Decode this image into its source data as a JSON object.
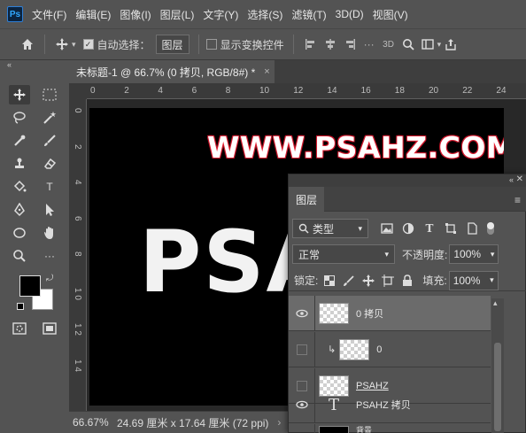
{
  "app": {
    "logo": "Ps"
  },
  "menu": [
    "文件(F)",
    "编辑(E)",
    "图像(I)",
    "图层(L)",
    "文字(Y)",
    "选择(S)",
    "滤镜(T)",
    "3D(D)",
    "视图(V)"
  ],
  "options": {
    "auto_select_label": "自动选择：",
    "auto_select_value": "图层",
    "show_transform_label": "显示变换控件"
  },
  "document_tab": {
    "title": "未标题-1 @ 66.7% (0 拷贝, RGB/8#) *",
    "close": "×"
  },
  "rulers": {
    "h_ticks": [
      "0",
      "2",
      "4",
      "6",
      "8",
      "10",
      "12",
      "14",
      "16",
      "18",
      "20",
      "22",
      "24"
    ],
    "v_ticks": [
      "0",
      "2",
      "4",
      "6",
      "8",
      "1 0",
      "1 2",
      "1 4"
    ]
  },
  "canvas": {
    "headline": "WWW.PSAHZ.COM",
    "big_text": "PSA",
    "headline_outline_color": "#d0142c"
  },
  "status": {
    "zoom": "66.67%",
    "doc_info": "24.69 厘米 x 17.64 厘米 (72 ppi)",
    "arrow": "›"
  },
  "layers_panel": {
    "tab_label": "图层",
    "filter_kind": "类型",
    "blend_mode": "正常",
    "opacity_label": "不透明度:",
    "opacity_value": "100%",
    "lock_label": "锁定:",
    "fill_label": "填充:",
    "fill_value": "100%",
    "layers": [
      {
        "name": "0 拷贝",
        "visible": true,
        "selected": true,
        "kind": "pixel"
      },
      {
        "name": "0",
        "visible": false,
        "selected": false,
        "kind": "pixel",
        "clipped": true
      },
      {
        "name": "PSAHZ",
        "visible": false,
        "selected": false,
        "kind": "pixel"
      },
      {
        "name": "PSAHZ 拷贝",
        "visible": true,
        "selected": false,
        "kind": "text"
      },
      {
        "name": "背景",
        "visible": true,
        "selected": false,
        "kind": "fill"
      }
    ]
  },
  "colors": {
    "foreground": "#000000",
    "background": "#ffffff",
    "accent": "#31a8ff"
  }
}
